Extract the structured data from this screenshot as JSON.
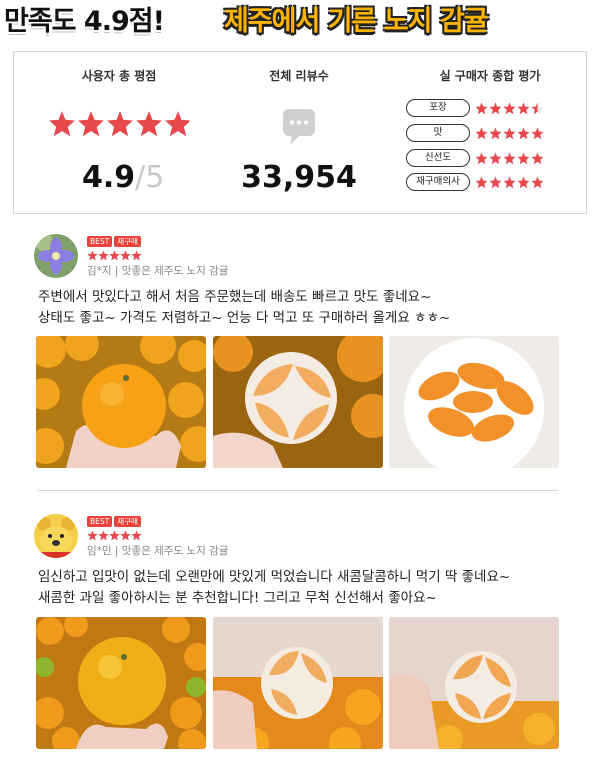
{
  "header": {
    "left_text": "만족도 4.9점!",
    "right_text": "제주에서 기른 노지 감귤"
  },
  "rating": {
    "avg_title": "사용자 총 평점",
    "avg_score": "4.9",
    "avg_max": "/5",
    "avg_stars": 4.9,
    "reviews_title": "전체 리뷰수",
    "reviews_count": "33,954",
    "breakdown_title": "실 구매자 종합 평가",
    "categories": [
      {
        "label": "포장",
        "stars": 4.5
      },
      {
        "label": "맛",
        "stars": 5
      },
      {
        "label": "신선도",
        "stars": 5
      },
      {
        "label": "재구매의사",
        "stars": 5
      }
    ]
  },
  "reviews": [
    {
      "badge_best": "BEST",
      "badge_repurchase": "재구매",
      "stars": 5,
      "meta": "김*지 | 맛좋은 제주도 노지 감귤",
      "line1": "주변에서 맛있다고 해서 처음 주문했는데 배송도 빠르고 맛도 좋네요~",
      "line2": "상태도 좋고~ 가격도 저렴하고~ 언능 다 먹고 또 구매하러 올게요 ㅎㅎ~",
      "avatar": "flower-avatar",
      "photos": [
        "tangerine-in-hand",
        "peeled-tangerine",
        "tangerine-segments"
      ]
    },
    {
      "badge_best": "BEST",
      "badge_repurchase": "재구매",
      "stars": 5,
      "meta": "임*민 | 맛좋은 제주도 노지 감귤",
      "line1": "임신하고 입맛이 없는데 오랜만에 맛있게 먹었습니다 새콤달콤하니 먹기 딱 좋네요~",
      "line2": "새콤한 과일 좋아하시는 분 추천합니다! 그리고 무척 신선해서 좋아요~",
      "avatar": "bear-avatar",
      "photos": [
        "tangerine-over-box",
        "peeled-tangerine-box",
        "peeled-tangerine-hand"
      ]
    }
  ],
  "colors": {
    "star": "#e8474c",
    "accent_yellow": "#ffb400",
    "orange": "#f39a1e"
  }
}
